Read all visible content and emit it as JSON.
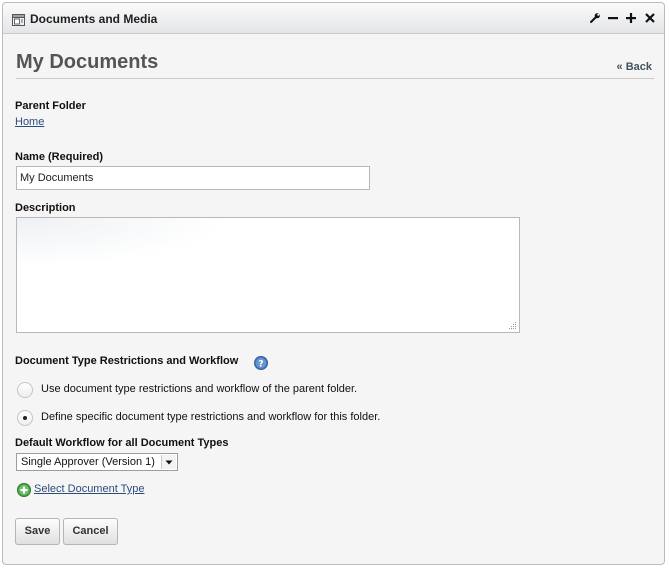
{
  "portlet": {
    "title": "Documents and Media",
    "icons": [
      "portlet-icon",
      "wrench-icon",
      "minimize-icon",
      "maximize-icon",
      "close-icon"
    ]
  },
  "page": {
    "title": "My Documents",
    "back_label": "« Back"
  },
  "form": {
    "parent_folder_label": "Parent Folder",
    "parent_folder_value": "Home",
    "name_label": "Name (Required)",
    "name_value": "My Documents",
    "description_label": "Description",
    "description_value": "",
    "restrictions_label": "Document Type Restrictions and Workflow",
    "radio_options": [
      {
        "label": "Use document type restrictions and workflow of the parent folder.",
        "checked": false
      },
      {
        "label": "Define specific document type restrictions and workflow for this folder.",
        "checked": true
      }
    ],
    "workflow_label": "Default Workflow for all Document Types",
    "workflow_selected": "Single Approver (Version 1)",
    "select_doc_type_label": "Select Document Type",
    "save_label": "Save",
    "cancel_label": "Cancel"
  },
  "colors": {
    "link": "#2c4d7a",
    "help_icon": "#4a7bc0",
    "add_icon": "#4ca64c"
  }
}
